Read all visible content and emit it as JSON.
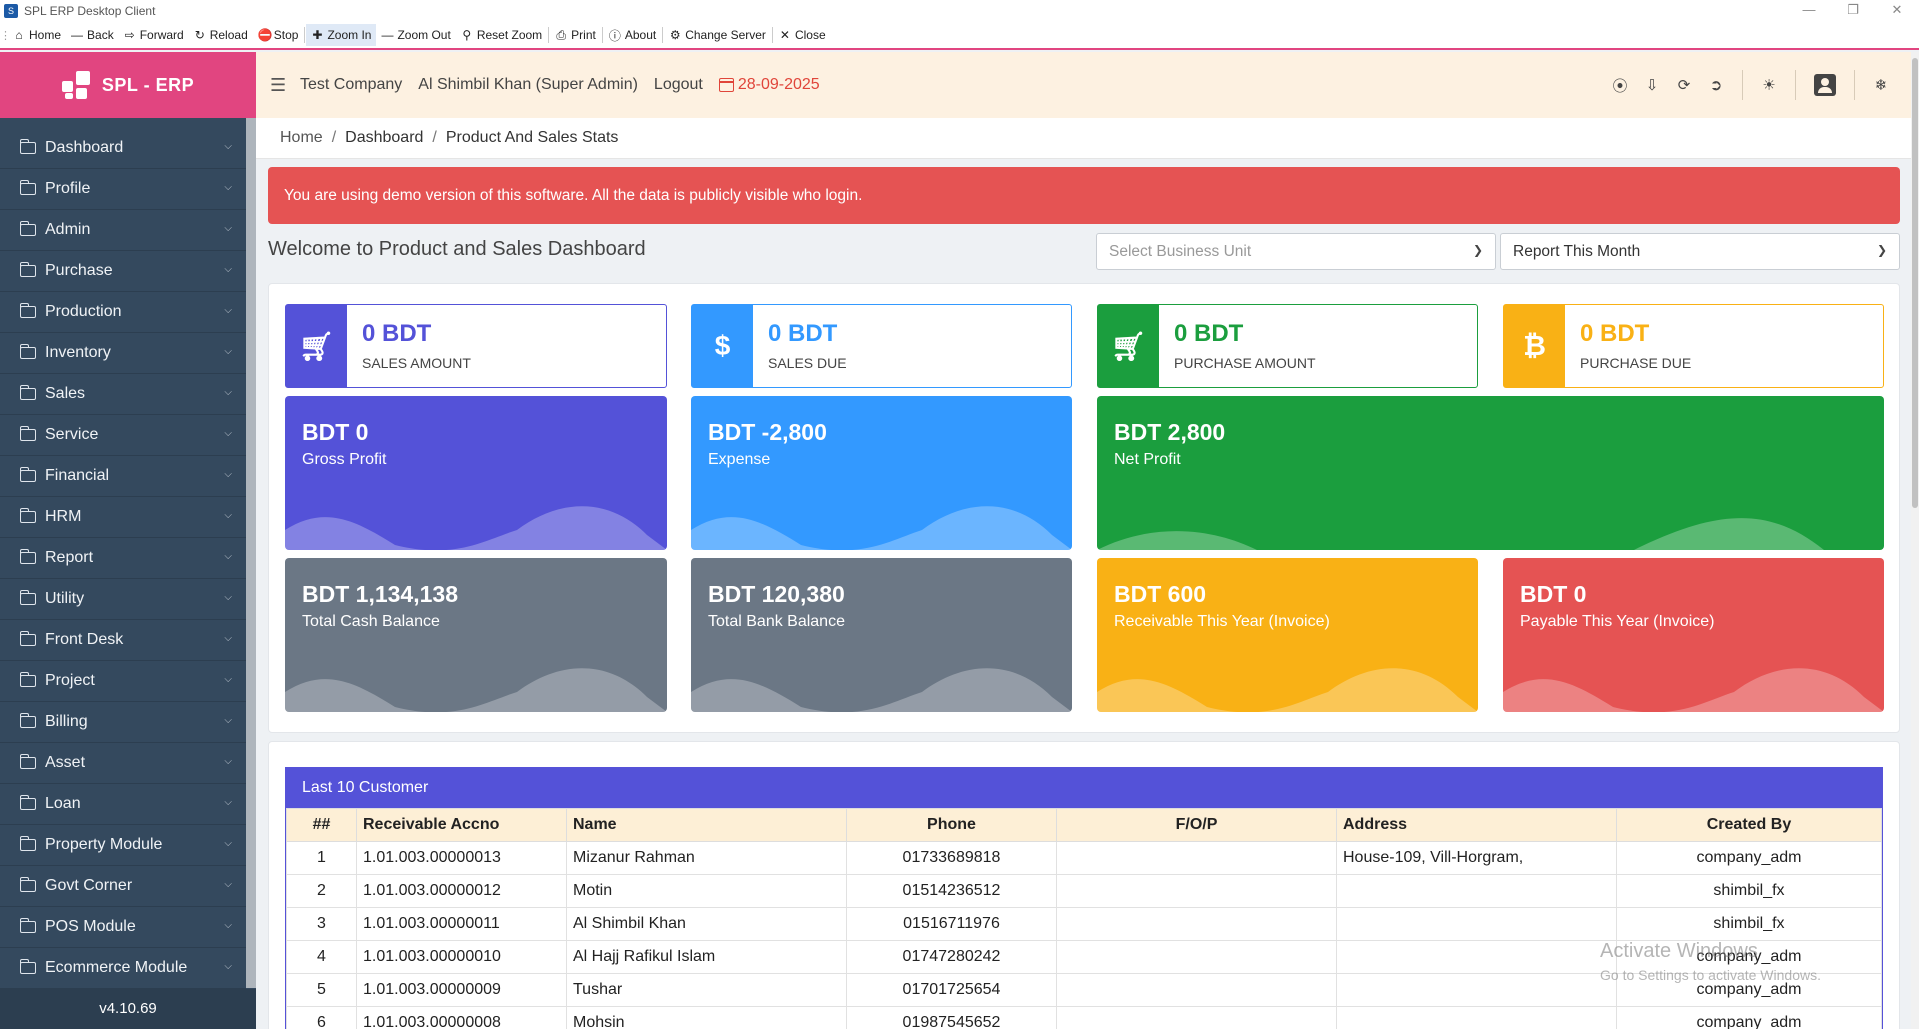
{
  "window": {
    "title": "SPL ERP Desktop Client"
  },
  "toolbar": {
    "home": "Home",
    "back": "Back",
    "forward": "Forward",
    "reload": "Reload",
    "stop": "Stop",
    "zoom_in": "Zoom In",
    "zoom_out": "Zoom Out",
    "reset_zoom": "Reset Zoom",
    "print": "Print",
    "about": "About",
    "change_server": "Change Server",
    "close": "Close"
  },
  "brand": {
    "name": "SPL - ERP"
  },
  "sidebar": {
    "items": [
      {
        "label": "Dashboard"
      },
      {
        "label": "Profile"
      },
      {
        "label": "Admin"
      },
      {
        "label": "Purchase"
      },
      {
        "label": "Production"
      },
      {
        "label": "Inventory"
      },
      {
        "label": "Sales"
      },
      {
        "label": "Service"
      },
      {
        "label": "Financial"
      },
      {
        "label": "HRM"
      },
      {
        "label": "Report"
      },
      {
        "label": "Utility"
      },
      {
        "label": "Front Desk"
      },
      {
        "label": "Project"
      },
      {
        "label": "Billing"
      },
      {
        "label": "Asset"
      },
      {
        "label": "Loan"
      },
      {
        "label": "Property Module"
      },
      {
        "label": "Govt Corner"
      },
      {
        "label": "POS Module"
      },
      {
        "label": "Ecommerce Module"
      }
    ],
    "version": "v4.10.69"
  },
  "header": {
    "company": "Test Company",
    "user": "Al Shimbil Khan (Super Admin)",
    "logout": "Logout",
    "date": "28-09-2025"
  },
  "breadcrumb": {
    "home": "Home",
    "dashboard": "Dashboard",
    "current": "Product And Sales Stats"
  },
  "alert": {
    "text": "You are using demo version of this software. All the data is publicly visible who login."
  },
  "dashboard": {
    "welcome": "Welcome to Product and Sales Dashboard",
    "business_unit_placeholder": "Select Business Unit",
    "report_period": "Report This Month"
  },
  "summary_cards": [
    {
      "value": "0 BDT",
      "label": "SALES AMOUNT",
      "icon": "cart-icon",
      "color": "#5452d8"
    },
    {
      "value": "0 BDT",
      "label": "SALES DUE",
      "icon": "dollar-icon",
      "color": "#3399ff"
    },
    {
      "value": "0 BDT",
      "label": "PURCHASE AMOUNT",
      "icon": "cart-plus-icon",
      "color": "#1b9e3e"
    },
    {
      "value": "0 BDT",
      "label": "PURCHASE DUE",
      "icon": "bitcoin-icon",
      "color": "#f9b115"
    }
  ],
  "stat_cards": [
    {
      "value": "BDT 0",
      "label": "Gross Profit",
      "color": "#5452d8"
    },
    {
      "value": "BDT -2,800",
      "label": "Expense",
      "color": "#3399ff"
    },
    {
      "value": "BDT 2,800",
      "label": "Net Profit",
      "color": "#1b9e3e"
    },
    {
      "value": "BDT 1,134,138",
      "label": "Total Cash Balance",
      "color": "#6b7785"
    },
    {
      "value": "BDT 120,380",
      "label": "Total Bank Balance",
      "color": "#6b7785"
    },
    {
      "value": "BDT 600",
      "label": "Receivable This Year (Invoice)",
      "color": "#f9b115"
    },
    {
      "value": "BDT 0",
      "label": "Payable This Year (Invoice)",
      "color": "#e55353"
    }
  ],
  "customers": {
    "title": "Last 10 Customer",
    "columns": [
      "##",
      "Receivable Accno",
      "Name",
      "Phone",
      "F/O/P",
      "Address",
      "Created By"
    ],
    "rows": [
      [
        "1",
        "1.01.003.00000013",
        "Mizanur Rahman",
        "01733689818",
        "",
        "House-109, Vill-Horgram,",
        "company_adm"
      ],
      [
        "2",
        "1.01.003.00000012",
        "Motin",
        "01514236512",
        "",
        "",
        "shimbil_fx"
      ],
      [
        "3",
        "1.01.003.00000011",
        "Al Shimbil Khan",
        "01516711976",
        "",
        "",
        "shimbil_fx"
      ],
      [
        "4",
        "1.01.003.00000010",
        "Al Hajj Rafikul Islam",
        "01747280242",
        "",
        "",
        "company_adm"
      ],
      [
        "5",
        "1.01.003.00000009",
        "Tushar",
        "01701725654",
        "",
        "",
        "company_adm"
      ],
      [
        "6",
        "1.01.003.00000008",
        "Mohsin",
        "01987545652",
        "",
        "",
        "company_adm"
      ]
    ]
  },
  "watermark": {
    "line1": "Activate Windows",
    "line2": "Go to Settings to activate Windows."
  }
}
